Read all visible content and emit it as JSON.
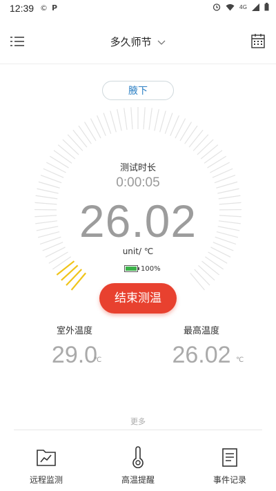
{
  "status_bar": {
    "time": "12:39",
    "left_icons": [
      "©",
      "P"
    ],
    "right_icons": [
      "alarm-icon",
      "wifi-icon",
      "4G",
      "signal-icon",
      "battery-icon"
    ]
  },
  "header": {
    "title": "多久师节",
    "menu_icon": "list-icon",
    "calendar_icon": "calendar-icon"
  },
  "mode": {
    "label": "腋下"
  },
  "measurement": {
    "test_time_label": "测试时长",
    "test_time": "0:00:05",
    "temperature": "26.02",
    "unit": "unit/ ℃",
    "battery_percent": "100%",
    "gauge_active_fraction": 0.06
  },
  "actions": {
    "end_button": "结束测温"
  },
  "stats": {
    "outdoor": {
      "label": "室外温度",
      "value": "29.0",
      "unit": "℃"
    },
    "max": {
      "label": "最高温度",
      "value": "26.02",
      "unit": "℃"
    }
  },
  "more": {
    "label": "更多"
  },
  "bottom_nav": [
    {
      "label": "远程监测",
      "icon": "chart-folder-icon"
    },
    {
      "label": "高温提醒",
      "icon": "thermometer-icon"
    },
    {
      "label": "事件记录",
      "icon": "document-icon"
    }
  ],
  "colors": {
    "accent_red": "#e8412f",
    "link_blue": "#2b7fc4",
    "gauge_active": "#f0c419",
    "gauge_inactive": "#e3e3e3"
  }
}
